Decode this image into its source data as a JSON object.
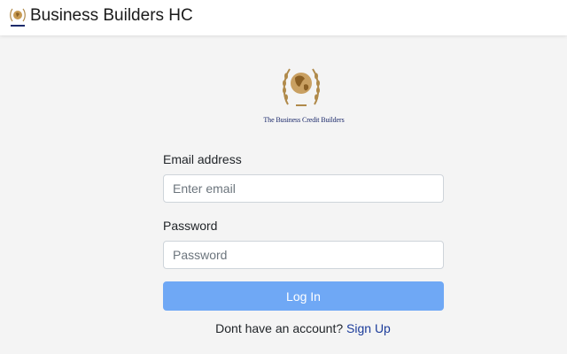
{
  "navbar": {
    "brand": "Business Builders HC",
    "logo_icon": "globe-laurel-logo-icon"
  },
  "logo": {
    "icon": "globe-laurel-logo-icon",
    "caption": "The Business Credit Builders"
  },
  "form": {
    "email_label": "Email address",
    "email_placeholder": "Enter email",
    "email_value": "",
    "password_label": "Password",
    "password_placeholder": "Password",
    "password_value": "",
    "login_label": "Log In"
  },
  "signup": {
    "prompt": "Dont have an account?",
    "link_label": "Sign Up"
  },
  "colors": {
    "button": "#6fa8f5",
    "link": "#1c3c9a",
    "logo_gold": "#b08a4a",
    "caption_blue": "#1c2a6b"
  }
}
